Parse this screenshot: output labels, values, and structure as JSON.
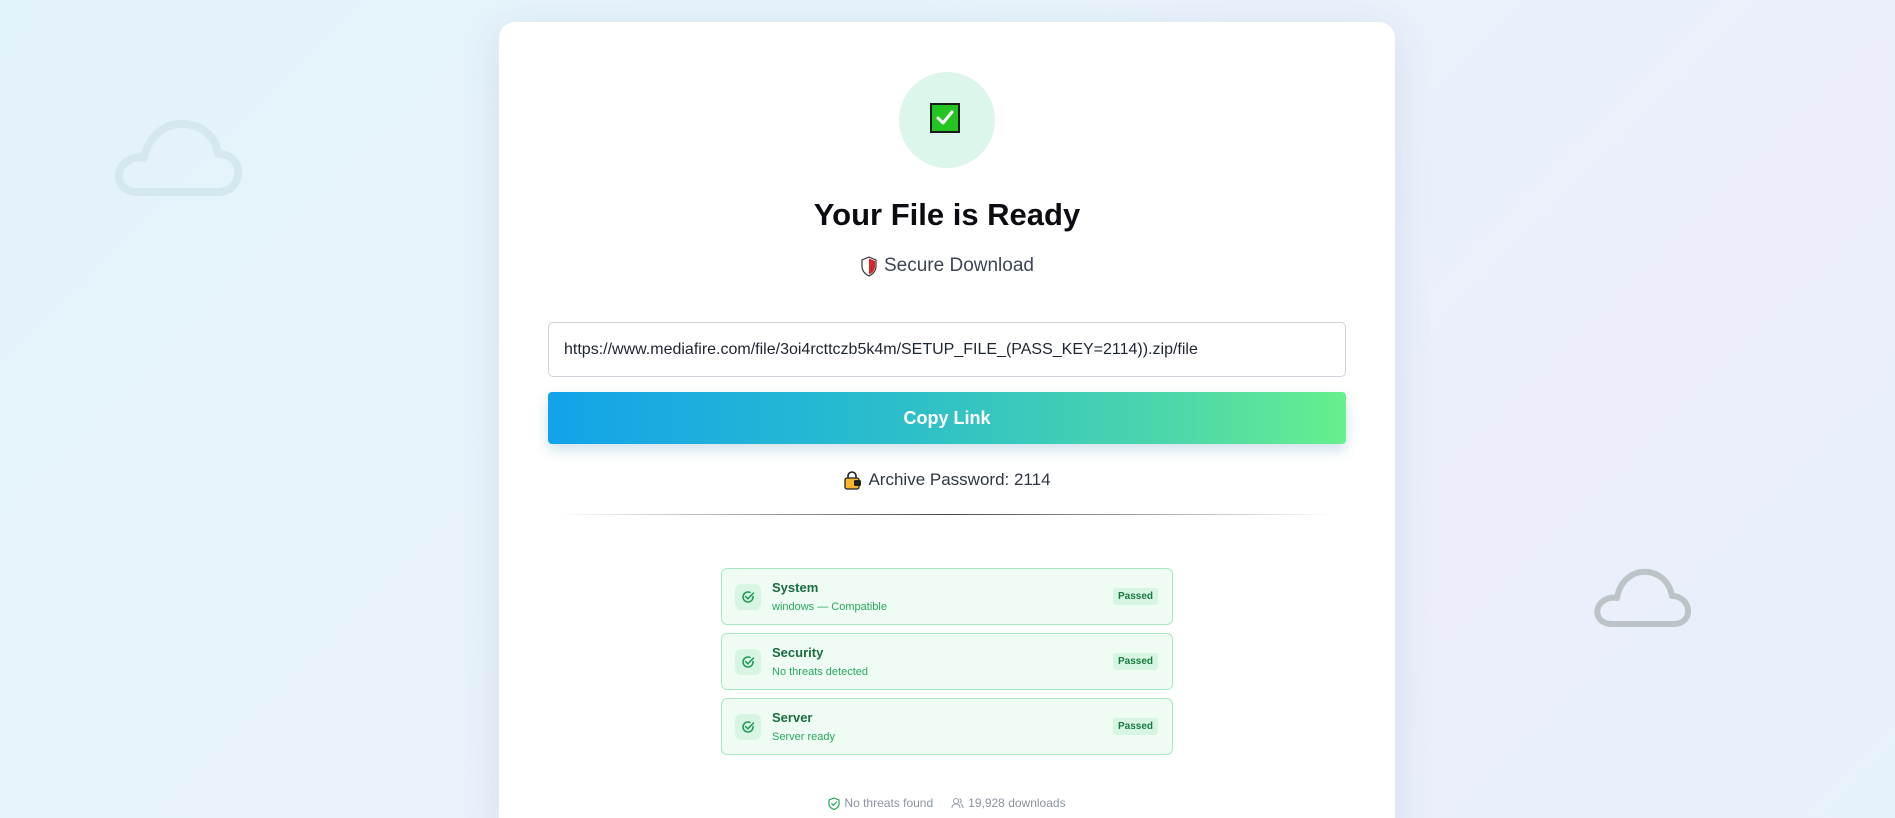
{
  "page": {
    "title": "Your File is Ready",
    "subtitle": "Secure Download",
    "icons": {
      "main": "check-mark-icon",
      "subtitle": "shield-icon",
      "password": "lock-icon"
    }
  },
  "download": {
    "url": "https://www.mediafire.com/file/3oi4rcttczb5k4m/SETUP_FILE_(PASS_KEY=2114)).zip/file",
    "copy_label": "Copy Link",
    "password_text": "Archive Password: 2114"
  },
  "checks": [
    {
      "title": "System",
      "subtitle": "windows — Compatible",
      "badge": "Passed"
    },
    {
      "title": "Security",
      "subtitle": "No threats detected",
      "badge": "Passed"
    },
    {
      "title": "Server",
      "subtitle": "Server ready",
      "badge": "Passed"
    }
  ],
  "footer": {
    "threats": "No threats found",
    "downloads": "19,928 downloads"
  },
  "colors": {
    "accent_start": "#12a3ea",
    "accent_end": "#66f08e",
    "success": "#1a6d3c",
    "check_green": "#22c522"
  }
}
